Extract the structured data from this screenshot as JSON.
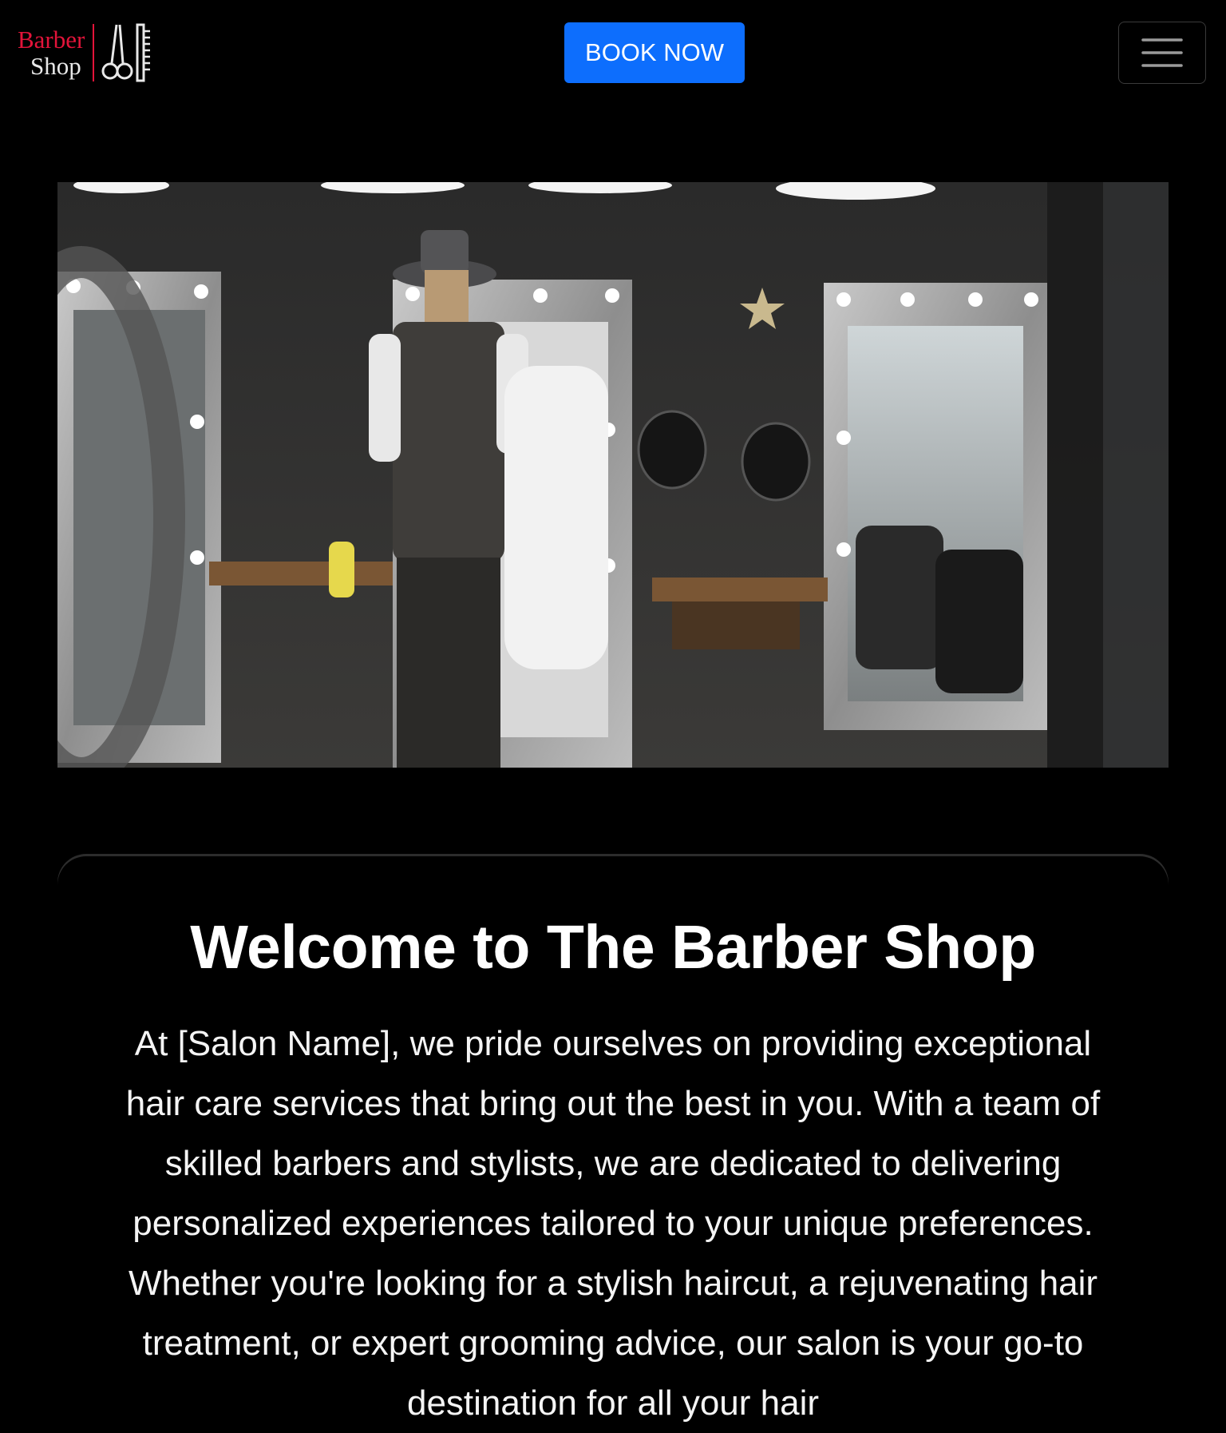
{
  "brand": {
    "line1": "Barber",
    "line2": "Shop",
    "accent_color": "#e3143a",
    "icon": "scissors-comb-icon"
  },
  "header": {
    "book_label": "BOOK NOW",
    "book_color": "#0d6efd",
    "menu_icon": "hamburger-menu-icon"
  },
  "hero": {
    "alt": "Barbershop interior with mirrors and barber chairs"
  },
  "welcome": {
    "title": "Welcome to The Barber Shop",
    "body": "At [Salon Name], we pride ourselves on providing exceptional hair care services that bring out the best in you. With a team of skilled barbers and stylists, we are dedicated to delivering personalized experiences tailored to your unique preferences. Whether you're looking for a stylish haircut, a rejuvenating hair treatment, or expert grooming advice, our salon is your go-to destination for all your hair"
  }
}
